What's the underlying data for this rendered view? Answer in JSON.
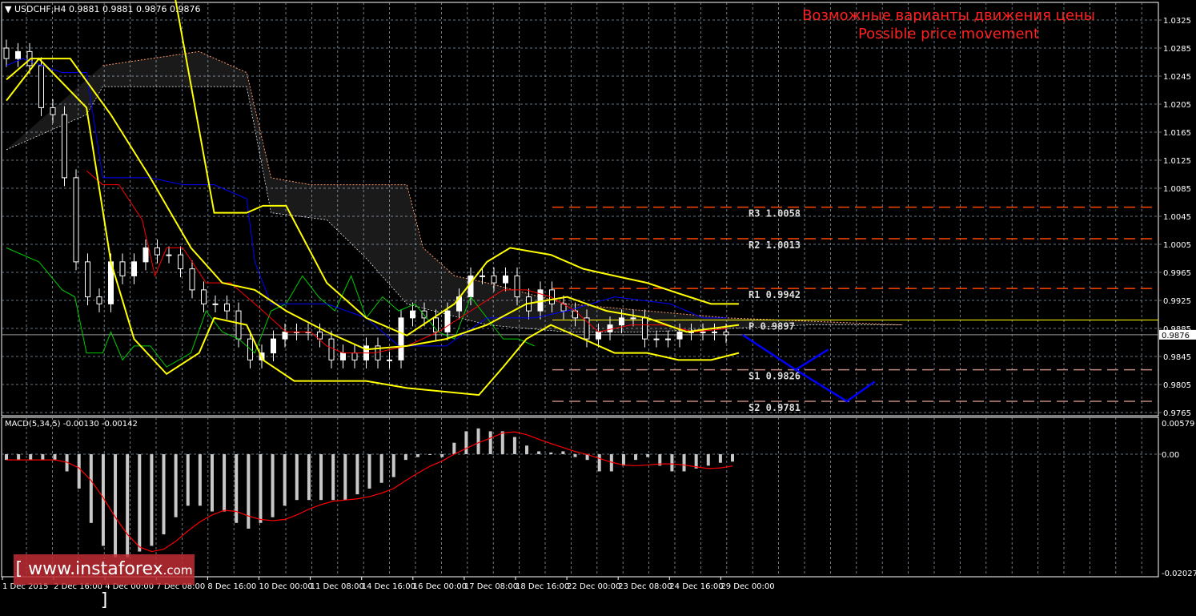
{
  "header": {
    "symbol": "USDCHF,H4",
    "ohlc": "0.9881 0.9881 0.9876 0.9876"
  },
  "title": {
    "line1": "Возможные варианты движения цены",
    "line2": "Possible price movement"
  },
  "macd_label": {
    "name": "MACD(5,34,5)",
    "values": "-0.00130 -0.00142"
  },
  "logo": {
    "text": "www.instaforex",
    "suffix": ".com",
    "bracket_open": "[",
    "bracket_close": "]"
  },
  "current_price": "0.9876",
  "colors": {
    "bg": "#000000",
    "grid": "#8899aa",
    "bands": "#ffff00",
    "tenkan": "#ff0000",
    "kijun": "#0000ff",
    "chikou": "#00cc00",
    "cloud": "#ffffff",
    "cloud2": "#ff9966",
    "pivot_r": "#ff4500",
    "pivot_s": "#c08a80",
    "projection": "#0000ff",
    "title": "#ff2020"
  },
  "chart_data": [
    {
      "type": "candlestick",
      "title": "USDCHF,H4",
      "ylim": [
        0.9745,
        1.035
      ],
      "y_ticks": [
        "1.0325",
        "1.0285",
        "1.0245",
        "1.0205",
        "1.0165",
        "1.0125",
        "1.0085",
        "1.0045",
        "1.0005",
        "0.9965",
        "0.9925",
        "0.9885",
        "0.9845",
        "0.9805",
        "0.9765"
      ],
      "x_ticks": [
        "1 Dec 2015",
        "2 Dec 16:00",
        "4 Dec 00:00",
        "7 Dec 08:00",
        "8 Dec 16:00",
        "10 Dec 00:00",
        "11 Dec 08:00",
        "14 Dec 16:00",
        "16 Dec 00:00",
        "17 Dec 08:00",
        "18 Dec 16:00",
        "22 Dec 00:00",
        "23 Dec 08:00",
        "24 Dec 16:00",
        "29 Dec 00:00"
      ],
      "closes": [
        1.027,
        1.028,
        1.026,
        1.02,
        1.019,
        1.01,
        0.998,
        0.993,
        0.992,
        0.998,
        0.996,
        0.998,
        1.0,
        0.999,
        0.999,
        0.997,
        0.994,
        0.992,
        0.992,
        0.991,
        0.987,
        0.984,
        0.985,
        0.987,
        0.988,
        0.988,
        0.988,
        0.987,
        0.984,
        0.985,
        0.984,
        0.986,
        0.984,
        0.984,
        0.99,
        0.991,
        0.99,
        0.988,
        0.991,
        0.993,
        0.996,
        0.996,
        0.995,
        0.996,
        0.993,
        0.991,
        0.994,
        0.992,
        0.991,
        0.99,
        0.987,
        0.988,
        0.989,
        0.99,
        0.99,
        0.987,
        0.987,
        0.987,
        0.988,
        0.988,
        0.988,
        0.988,
        0.9876
      ],
      "indicators": {
        "bb_upper": [
          [
            14.5,
            1.036
          ],
          [
            17.9,
            1.005
          ],
          [
            20.7,
            1.005
          ],
          [
            22.1,
            1.006
          ],
          [
            24.1,
            1.006
          ],
          [
            27.6,
            0.995
          ],
          [
            31,
            0.99
          ],
          [
            34.5,
            0.9875
          ],
          [
            38.6,
            0.992
          ],
          [
            41.4,
            0.998
          ],
          [
            43.4,
            1.0
          ],
          [
            46.9,
            0.999
          ],
          [
            49.7,
            0.997
          ],
          [
            52.4,
            0.996
          ],
          [
            55.2,
            0.995
          ],
          [
            57.9,
            0.9935
          ],
          [
            60.7,
            0.992
          ],
          [
            63.1,
            0.992
          ]
        ],
        "bb_middle": [
          [
            0,
            1.024
          ],
          [
            2.1,
            1.027
          ],
          [
            5.5,
            1.027
          ],
          [
            9,
            1.019
          ],
          [
            12.4,
            1.01
          ],
          [
            15.9,
            1.0
          ],
          [
            18.6,
            0.995
          ],
          [
            21.4,
            0.994
          ],
          [
            24.1,
            0.991
          ],
          [
            27.6,
            0.988
          ],
          [
            31,
            0.9855
          ],
          [
            34.5,
            0.986
          ],
          [
            37.9,
            0.987
          ],
          [
            41.4,
            0.989
          ],
          [
            44.8,
            0.992
          ],
          [
            48.3,
            0.993
          ],
          [
            51.7,
            0.991
          ],
          [
            55.2,
            0.99
          ],
          [
            58.6,
            0.988
          ],
          [
            63.1,
            0.989
          ]
        ],
        "bb_lower": [
          [
            0,
            1.021
          ],
          [
            2.8,
            1.027
          ],
          [
            6.9,
            1.02
          ],
          [
            9,
            0.998
          ],
          [
            11,
            0.987
          ],
          [
            13.8,
            0.982
          ],
          [
            16.6,
            0.985
          ],
          [
            17.9,
            0.99
          ],
          [
            20.7,
            0.989
          ],
          [
            22.1,
            0.984
          ],
          [
            24.8,
            0.981
          ],
          [
            27.6,
            0.981
          ],
          [
            31,
            0.981
          ],
          [
            34.5,
            0.98
          ],
          [
            40.7,
            0.979
          ],
          [
            42.8,
            0.983
          ],
          [
            44.8,
            0.987
          ],
          [
            46.9,
            0.989
          ],
          [
            49.7,
            0.987
          ],
          [
            52.4,
            0.985
          ],
          [
            55.2,
            0.985
          ],
          [
            57.9,
            0.984
          ],
          [
            60.7,
            0.984
          ],
          [
            63.1,
            0.985
          ]
        ],
        "tenkan": [
          [
            6.9,
            1.011
          ],
          [
            8.3,
            1.009
          ],
          [
            9.7,
            1.009
          ],
          [
            11.7,
            1.004
          ],
          [
            12.8,
            0.996
          ],
          [
            13.8,
            1.0
          ],
          [
            15.2,
            1.0
          ],
          [
            17.2,
            0.995
          ],
          [
            19.3,
            0.995
          ],
          [
            20.7,
            0.993
          ],
          [
            22.1,
            0.991
          ],
          [
            24.1,
            0.988
          ],
          [
            26.2,
            0.988
          ],
          [
            27.6,
            0.986
          ],
          [
            29,
            0.985
          ],
          [
            31.7,
            0.985
          ],
          [
            34.5,
            0.986
          ],
          [
            37.2,
            0.988
          ],
          [
            40,
            0.991
          ],
          [
            42.8,
            0.994
          ],
          [
            44.8,
            0.994
          ],
          [
            46.9,
            0.993
          ],
          [
            49,
            0.991
          ],
          [
            51,
            0.988
          ],
          [
            53.8,
            0.989
          ],
          [
            56.6,
            0.989
          ],
          [
            59.3,
            0.988
          ],
          [
            62.1,
            0.9885
          ]
        ],
        "kijun": [
          [
            0,
            1.026
          ],
          [
            1.4,
            1.027
          ],
          [
            4.8,
            1.025
          ],
          [
            6.9,
            1.025
          ],
          [
            8.3,
            1.01
          ],
          [
            12.4,
            1.01
          ],
          [
            15.2,
            1.009
          ],
          [
            17.9,
            1.009
          ],
          [
            20.7,
            1.007
          ],
          [
            21.4,
            0.998
          ],
          [
            22.8,
            0.992
          ],
          [
            27.6,
            0.992
          ],
          [
            31,
            0.99
          ],
          [
            33.8,
            0.986
          ],
          [
            37.9,
            0.986
          ],
          [
            41.4,
            0.99
          ],
          [
            45.5,
            0.99
          ],
          [
            48.3,
            0.991
          ],
          [
            52.4,
            0.993
          ],
          [
            57.2,
            0.992
          ],
          [
            60,
            0.99
          ],
          [
            62.1,
            0.99
          ]
        ],
        "chikou": [
          [
            0,
            1.0
          ],
          [
            2.8,
            0.998
          ],
          [
            4.8,
            0.994
          ],
          [
            5.9,
            0.993
          ],
          [
            6.9,
            0.985
          ],
          [
            8.3,
            0.985
          ],
          [
            9,
            0.988
          ],
          [
            10,
            0.984
          ],
          [
            11,
            0.986
          ],
          [
            12.4,
            0.986
          ],
          [
            13.8,
            0.983
          ],
          [
            15.9,
            0.985
          ],
          [
            17.2,
            0.991
          ],
          [
            18.6,
            0.988
          ],
          [
            20,
            0.987
          ],
          [
            21.4,
            0.985
          ],
          [
            22.8,
            0.991
          ],
          [
            24.1,
            0.992
          ],
          [
            25.5,
            0.996
          ],
          [
            26.9,
            0.993
          ],
          [
            28.3,
            0.991
          ],
          [
            29.7,
            0.996
          ],
          [
            31,
            0.99
          ],
          [
            32.4,
            0.993
          ],
          [
            33.8,
            0.991
          ],
          [
            35.2,
            0.992
          ],
          [
            37.2,
            0.988
          ],
          [
            38.6,
            0.987
          ],
          [
            40,
            0.993
          ],
          [
            41.4,
            0.99
          ],
          [
            42.8,
            0.987
          ],
          [
            44.1,
            0.987
          ],
          [
            45.5,
            0.986
          ]
        ],
        "span_a": [
          [
            8.3,
            1.026
          ],
          [
            16.6,
            1.028
          ],
          [
            20.7,
            1.025
          ],
          [
            22.8,
            1.01
          ],
          [
            26.2,
            1.009
          ],
          [
            34.5,
            1.009
          ],
          [
            35.9,
            1.0
          ],
          [
            38.6,
            0.996
          ],
          [
            41.4,
            0.995
          ],
          [
            48.3,
            0.992
          ],
          [
            55.2,
            0.991
          ],
          [
            62.1,
            0.99
          ],
          [
            77.2,
            0.989
          ]
        ],
        "span_b": [
          [
            0,
            1.014
          ],
          [
            6.9,
            1.019
          ],
          [
            8.3,
            1.023
          ],
          [
            20.7,
            1.023
          ],
          [
            22.8,
            1.005
          ],
          [
            27.6,
            1.004
          ],
          [
            31,
            0.9985
          ],
          [
            34.5,
            0.992
          ],
          [
            41.4,
            0.989
          ],
          [
            48.3,
            0.988
          ],
          [
            55.2,
            0.988
          ],
          [
            69,
            0.989
          ],
          [
            77.2,
            0.989
          ]
        ]
      },
      "pivots": [
        {
          "label": "R3",
          "value": "1.0058",
          "kind": "r"
        },
        {
          "label": "R2",
          "value": "1.0013",
          "kind": "r"
        },
        {
          "label": "R1",
          "value": "0.9942",
          "kind": "r"
        },
        {
          "label": "P",
          "value": "0.9897",
          "kind": "p"
        },
        {
          "label": "S1",
          "value": "0.9826",
          "kind": "s"
        },
        {
          "label": "S2",
          "value": "0.9781",
          "kind": "s"
        }
      ],
      "projections": [
        [
          [
            63.4,
            0.9876
          ],
          [
            68,
            0.9826
          ],
          [
            70.8,
            0.9855
          ]
        ],
        [
          [
            68,
            0.9826
          ],
          [
            72.4,
            0.9781
          ],
          [
            74.8,
            0.9809
          ]
        ]
      ]
    },
    {
      "type": "bar",
      "title": "MACD(5,34,5)",
      "ylim": [
        -0.02027,
        0.00579
      ],
      "y_ticks": [
        "0.00579",
        "0.00",
        "-0.02027"
      ],
      "histogram": [
        -0.001,
        -0.001,
        -0.001,
        -0.001,
        -0.001,
        -0.003,
        -0.006,
        -0.012,
        -0.016,
        -0.018,
        -0.018,
        -0.017,
        -0.016,
        -0.014,
        -0.011,
        -0.009,
        -0.009,
        -0.01,
        -0.01,
        -0.012,
        -0.013,
        -0.012,
        -0.011,
        -0.009,
        -0.008,
        -0.008,
        -0.008,
        -0.008,
        -0.008,
        -0.007,
        -0.006,
        -0.005,
        -0.004,
        -0.001,
        -0.0005,
        0.0,
        -0.0005,
        0.002,
        0.004,
        0.0045,
        0.004,
        0.004,
        0.003,
        0.0015,
        0.0005,
        0.0003,
        0.0005,
        -0.0005,
        -0.001,
        -0.003,
        -0.003,
        -0.002,
        -0.001,
        -0.0005,
        -0.002,
        -0.003,
        -0.003,
        -0.0025,
        -0.002,
        -0.0015,
        -0.0013
      ],
      "signal_period": 5
    }
  ]
}
